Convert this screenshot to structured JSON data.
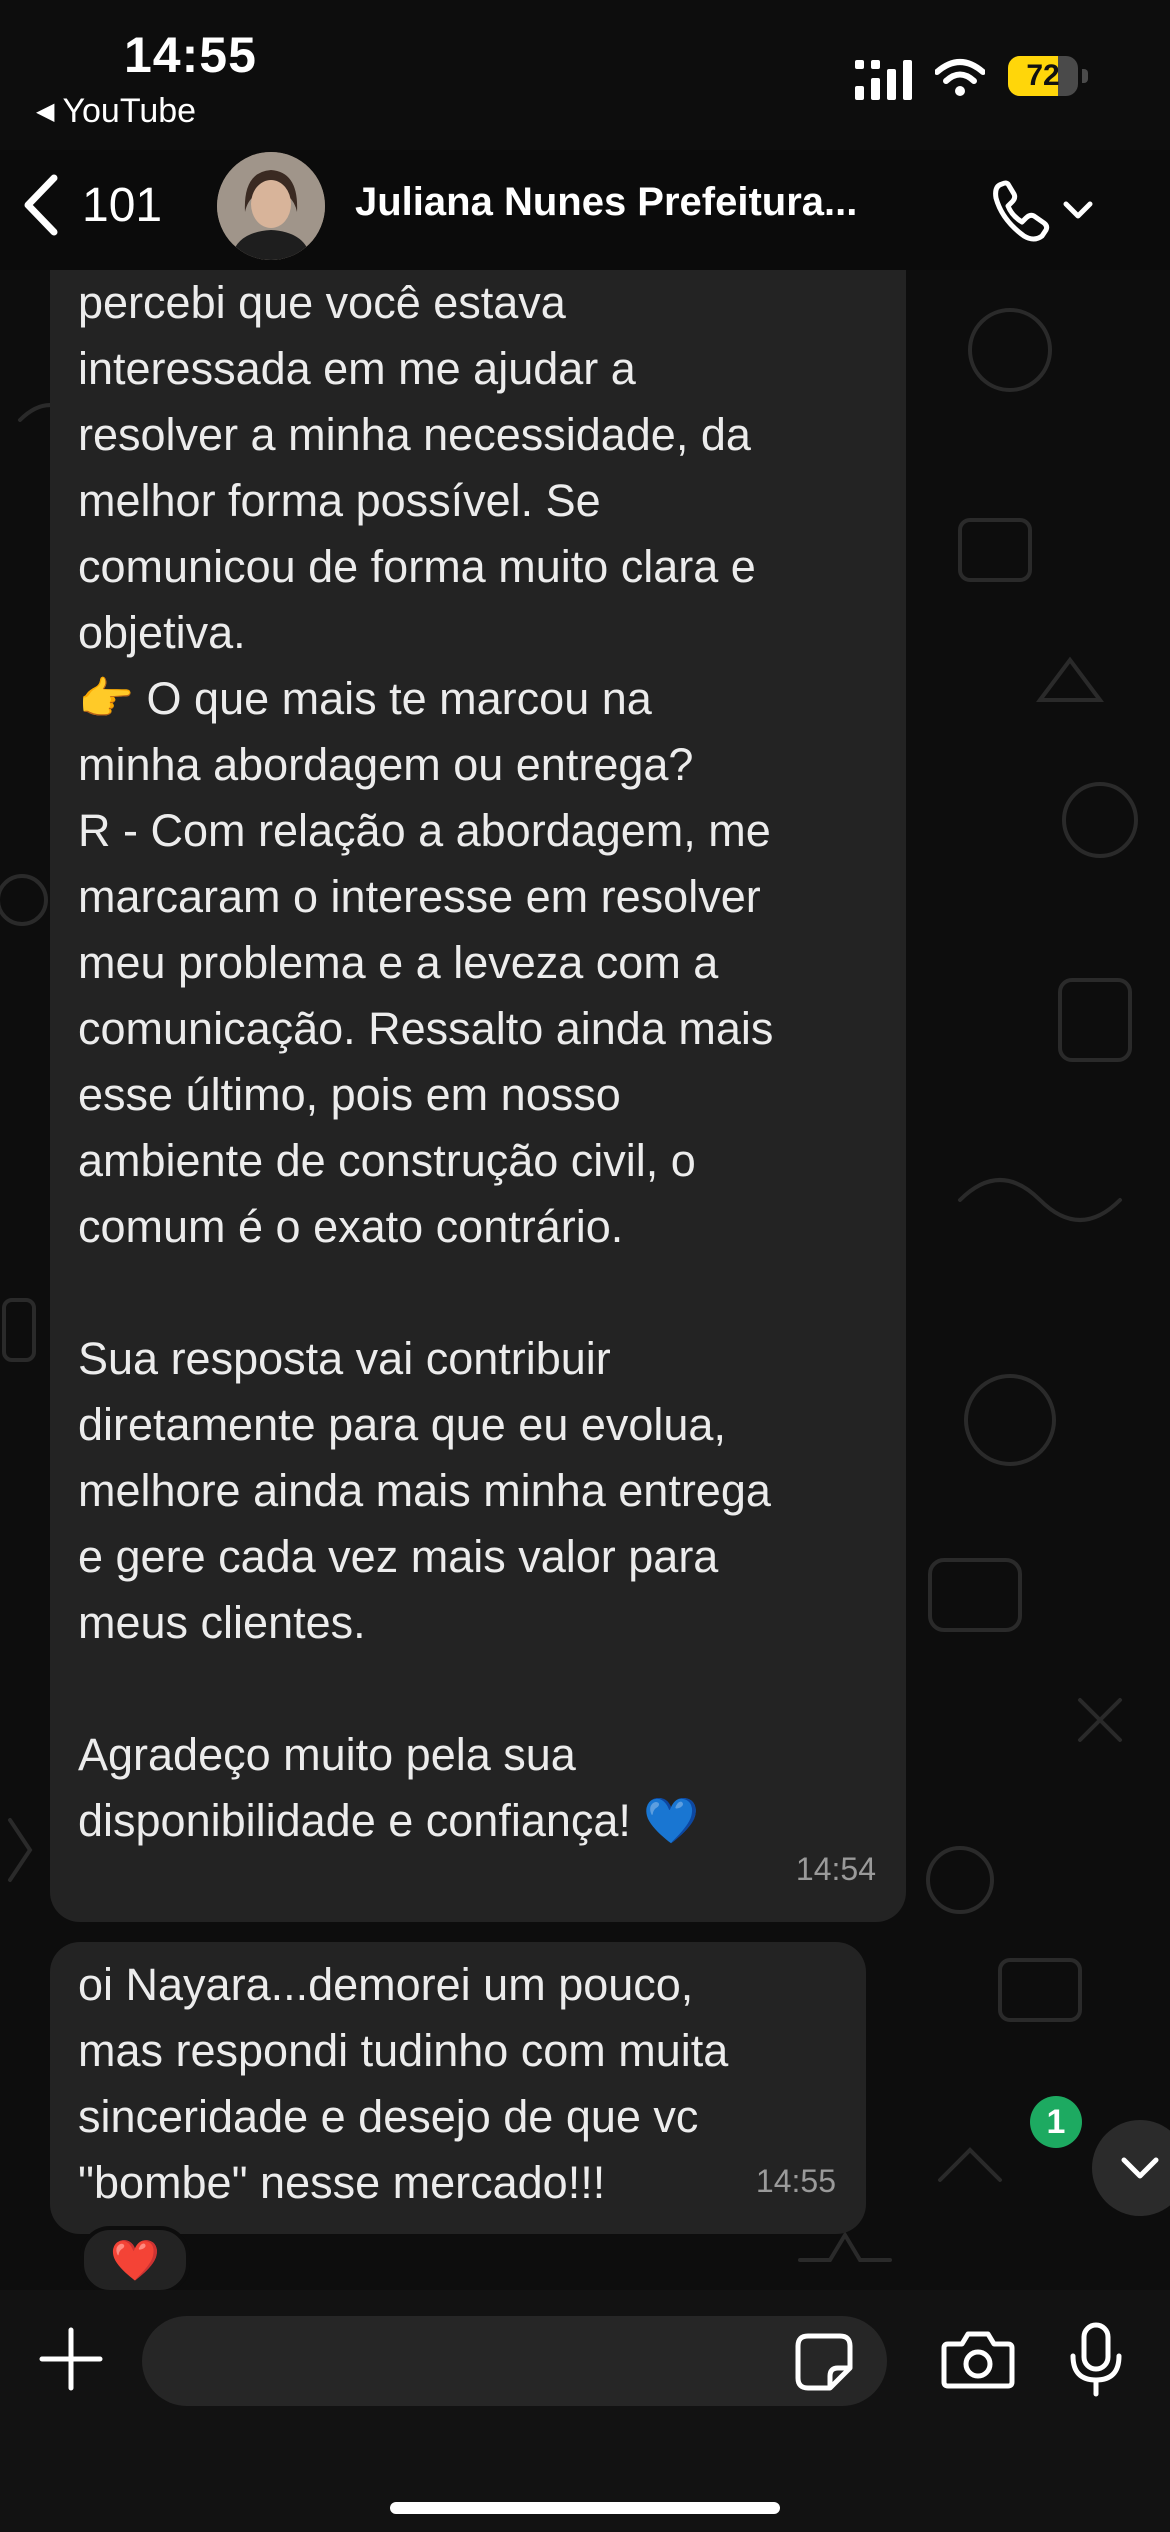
{
  "status_bar": {
    "time": "14:55",
    "back_app": "YouTube",
    "battery_level": "72",
    "battery_fraction": 0.72,
    "battery_color": "#ffd60a"
  },
  "header": {
    "unread_count": "101",
    "contact_name": "Juliana Nunes Prefeitura..."
  },
  "messages": [
    {
      "text": "percebi que você estava\ninteressada em me ajudar a\nresolver a minha necessidade, da\nmelhor forma possível. Se\ncomunicou de forma muito clara e\nobjetiva.\n👉 O que mais te marcou na\nminha abordagem ou entrega?\nR - Com relação a abordagem, me\nmarcaram o interesse em resolver\nmeu problema e a leveza com a\ncomunicação. Ressalto ainda mais\nesse último, pois em nosso\nambiente de construção civil, o\ncomum é o exato contrário.\n\nSua resposta vai contribuir\ndiretamente para que eu evolua,\nmelhore ainda mais minha entrega\ne gere cada vez mais valor para\nmeus clientes.\n\nAgradeço muito pela sua\ndisponibilidade e confiança! 💙",
      "time": "14:54"
    },
    {
      "text": "oi Nayara...demorei um pouco,\nmas respondi tudinho com muita\nsinceridade e desejo de que vc\n\"bombe\" nesse mercado!!!",
      "time": "14:55",
      "reaction": "❤️"
    }
  ],
  "scroll": {
    "new_messages": "1"
  },
  "composer": {
    "placeholder": ""
  },
  "colors": {
    "bubble": "#232323",
    "background": "#0d0d0d",
    "badge": "#1daa61"
  }
}
